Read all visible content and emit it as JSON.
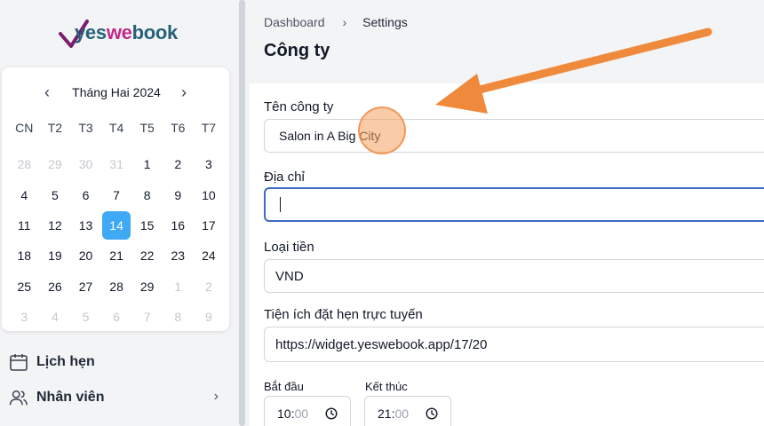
{
  "brand": {
    "logo_text_a": "yes",
    "logo_text_b": "we",
    "logo_text_c": "book"
  },
  "calendar": {
    "month_label": "Tháng Hai 2024",
    "prev_symbol": "‹",
    "next_symbol": "›",
    "weekdays": [
      "CN",
      "T2",
      "T3",
      "T4",
      "T5",
      "T6",
      "T7"
    ],
    "weeks": [
      [
        {
          "d": "28",
          "m": true
        },
        {
          "d": "29",
          "m": true
        },
        {
          "d": "30",
          "m": true
        },
        {
          "d": "31",
          "m": true
        },
        {
          "d": "1"
        },
        {
          "d": "2"
        },
        {
          "d": "3"
        }
      ],
      [
        {
          "d": "4"
        },
        {
          "d": "5"
        },
        {
          "d": "6"
        },
        {
          "d": "7"
        },
        {
          "d": "8"
        },
        {
          "d": "9"
        },
        {
          "d": "10"
        }
      ],
      [
        {
          "d": "11"
        },
        {
          "d": "12"
        },
        {
          "d": "13"
        },
        {
          "d": "14",
          "s": true
        },
        {
          "d": "15"
        },
        {
          "d": "16"
        },
        {
          "d": "17"
        }
      ],
      [
        {
          "d": "18"
        },
        {
          "d": "19"
        },
        {
          "d": "20"
        },
        {
          "d": "21"
        },
        {
          "d": "22"
        },
        {
          "d": "23"
        },
        {
          "d": "24"
        }
      ],
      [
        {
          "d": "25"
        },
        {
          "d": "26"
        },
        {
          "d": "27"
        },
        {
          "d": "28"
        },
        {
          "d": "29"
        },
        {
          "d": "1",
          "m": true
        },
        {
          "d": "2",
          "m": true
        }
      ],
      [
        {
          "d": "3",
          "m": true
        },
        {
          "d": "4",
          "m": true
        },
        {
          "d": "5",
          "m": true
        },
        {
          "d": "6",
          "m": true
        },
        {
          "d": "7",
          "m": true
        },
        {
          "d": "8",
          "m": true
        },
        {
          "d": "9",
          "m": true
        }
      ]
    ],
    "selected_color": "#3fa9f5"
  },
  "nav": {
    "appointments_label": "Lịch hẹn",
    "staff_label": "Nhân viên",
    "chevron": "›"
  },
  "breadcrumb": {
    "home": "Dashboard",
    "sep": "›",
    "current": "Settings"
  },
  "page": {
    "title": "Công ty"
  },
  "form": {
    "company_name_label": "Tên công ty",
    "company_name_value": "Salon in A Big City",
    "address_label": "Địa chỉ",
    "address_value": "",
    "currency_label": "Loại tiền",
    "currency_value": "VND",
    "widget_label": "Tiện ích đặt hẹn trực tuyến",
    "widget_value": "https://widget.yeswebook.app/17/20",
    "start_label": "Bắt đầu",
    "start_hh": "10:",
    "start_mm": "00",
    "end_label": "Kết thúc",
    "end_hh": "21:",
    "end_mm": "00"
  },
  "colors": {
    "accent": "#3b6cc9",
    "annotation": "#ef8a3c",
    "brand_teal": "#26617a",
    "brand_magenta": "#c12a8a"
  }
}
